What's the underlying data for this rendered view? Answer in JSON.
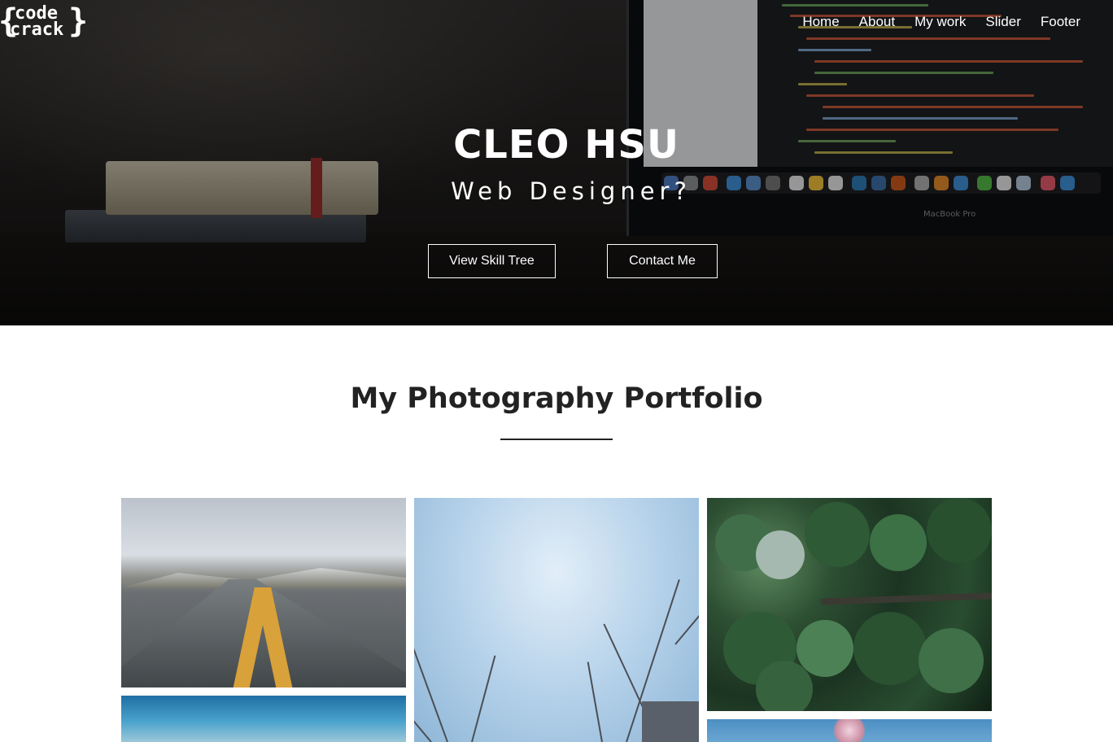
{
  "brand": {
    "logo_line1": "code",
    "logo_line2": "crack"
  },
  "nav": {
    "items": [
      {
        "label": "Home"
      },
      {
        "label": "About"
      },
      {
        "label": "My work"
      },
      {
        "label": "Slider"
      },
      {
        "label": "Footer"
      }
    ]
  },
  "hero": {
    "title": "CLEO HSU",
    "subtitle": "Web Designer?",
    "buttons": {
      "skill_label": "View Skill Tree",
      "contact_label": "Contact Me"
    },
    "laptop_brand": "MacBook Pro"
  },
  "portfolio": {
    "title": "My Photography Portfolio",
    "photos": [
      {
        "name": "road-photo",
        "subject": "road"
      },
      {
        "name": "sky-trees-photo",
        "subject": "sky"
      },
      {
        "name": "forest-aerial-photo",
        "subject": "forest"
      },
      {
        "name": "ocean-photo",
        "subject": "ocean"
      },
      {
        "name": "blossom-photo",
        "subject": "blossom"
      }
    ]
  },
  "colors": {
    "text_dark": "#222222",
    "hero_text": "#ffffff",
    "accent_yellow": "#d8a13a"
  }
}
